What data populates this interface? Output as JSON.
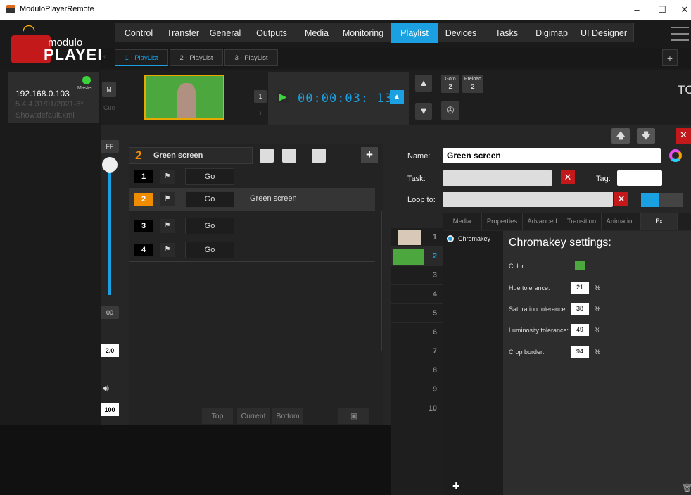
{
  "window": {
    "title": "ModuloPlayerRemote",
    "minimize": "–",
    "maximize": "☐",
    "close": "✕"
  },
  "logo": {
    "line1": "modulo",
    "line2": "PLAYER"
  },
  "menu": [
    "Control",
    "Transfer",
    "General",
    "Outputs",
    "Media",
    "Monitoring",
    "Playlist",
    "Devices",
    "Tasks",
    "Digimap",
    "UI Designer"
  ],
  "tabs": [
    "1 - PlayList",
    "2 - PlayList",
    "3 - PlayList"
  ],
  "tab_add": "+",
  "device": {
    "ip": "192.168.0.103",
    "version": "5.4.4 31/01/2021-6*",
    "show": "Show:default.xml",
    "role": "Master"
  },
  "preview": {
    "m_label": "M",
    "cue_label": "Cue",
    "cue_num": "1",
    "plus": "+",
    "timecode": "00:00:03: 13",
    "goto_label": "Goto",
    "goto_val": "2",
    "preload_label": "Preload",
    "preload_val": "2",
    "tc_label": "TC"
  },
  "levels": {
    "ff": "FF",
    "zero": "00",
    "speed": "2.0",
    "volume": "100"
  },
  "cue_header": {
    "num": "2",
    "name": "Green screen",
    "add": "+"
  },
  "cues": [
    {
      "num": "1",
      "go": "Go",
      "label": ""
    },
    {
      "num": "2",
      "go": "Go",
      "label": "Green screen"
    },
    {
      "num": "3",
      "go": "Go",
      "label": ""
    },
    {
      "num": "4",
      "go": "Go",
      "label": ""
    }
  ],
  "bottom_buttons": [
    "Top",
    "Current",
    "Bottom"
  ],
  "cue_numbers": [
    "1",
    "2",
    "3",
    "4",
    "5",
    "6",
    "7",
    "8",
    "9",
    "10"
  ],
  "props": {
    "name_label": "Name:",
    "name_value": "Green screen",
    "task_label": "Task:",
    "tag_label": "Tag:",
    "loop_label": "Loop to:"
  },
  "fx_tabs": [
    "Media",
    "Properties",
    "Advanced",
    "Transition",
    "Animation",
    "Fx"
  ],
  "fx_list": [
    "Chromakey"
  ],
  "fx_add": "+",
  "chromakey": {
    "title": "Chromakey settings:",
    "color_label": "Color:",
    "color": "#4ca83e",
    "pct": "%",
    "fields": [
      {
        "label": "Hue tolerance:",
        "value": "21"
      },
      {
        "label": "Saturation tolerance:",
        "value": "38"
      },
      {
        "label": "Luminosity tolerance:",
        "value": "49"
      },
      {
        "label": "Crop border:",
        "value": "94"
      }
    ]
  },
  "accent": "#1ba1e2",
  "highlight": "#f08c00"
}
